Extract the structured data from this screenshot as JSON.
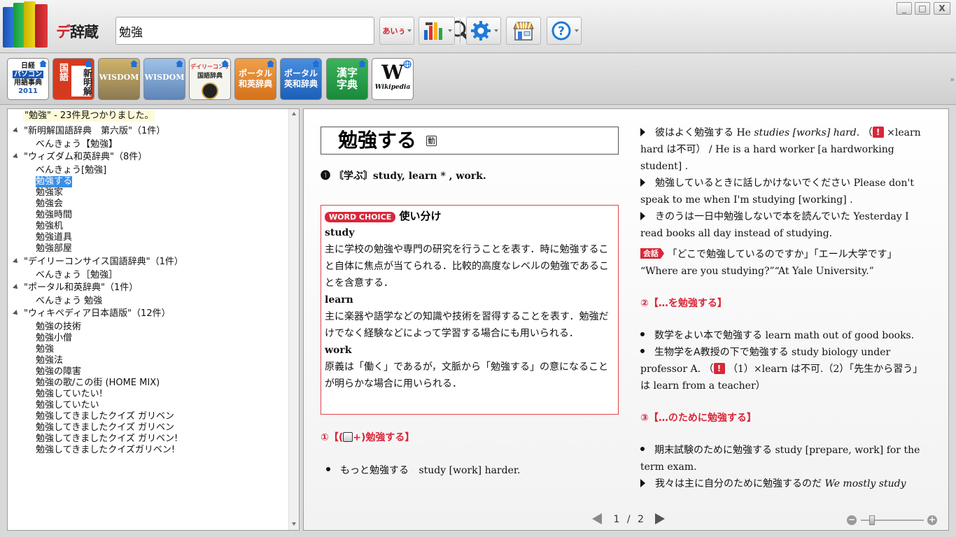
{
  "toolbar": {
    "app_title_prefix": "デ",
    "app_title_rest": "辞蔵",
    "search_value": "勉強",
    "search_placeholder": "",
    "kana_button_label": "あいぅ",
    "icons": [
      "search-icon",
      "histogram-icon",
      "gear-icon",
      "shop-icon",
      "help-icon"
    ]
  },
  "window": {
    "minimize": "_",
    "restore": "□",
    "close": "X"
  },
  "dicts": [
    {
      "label": "日経パソコン用語事典2011",
      "short1": "日経",
      "short2": "パソコン",
      "short3": "用語事典",
      "short4": "2011"
    },
    {
      "label": "新明解国語辞典",
      "short1": "国語",
      "short2": "新明解"
    },
    {
      "label": "ウィズダム英和辞典",
      "short1": "WISDOM"
    },
    {
      "label": "ウィズダム和英辞典",
      "short1": "WISDOM"
    },
    {
      "label": "デイリーコンサイス国語辞典",
      "short1": "デイリーコンサ",
      "short2": "国語辞典"
    },
    {
      "label": "ポータル和英辞典",
      "short1": "ポータル",
      "short2": "和英辞典"
    },
    {
      "label": "ポータル英和辞典",
      "short1": "ポータル",
      "short2": "英和辞典"
    },
    {
      "label": "学研漢字字典",
      "short1": "漢字",
      "short2": "字典"
    },
    {
      "label": "Wikipedia",
      "short1": "W",
      "short2": "Wikipedia"
    }
  ],
  "tree": {
    "summary": "\"勉強\" - 23件見つかりました。",
    "groups": [
      {
        "title": "\"新明解国語辞典　第六版\"（1件）",
        "items": [
          "べんきょう【勉強】"
        ]
      },
      {
        "title": "\"ウィズダム和英辞典\"（8件）",
        "items": [
          "べんきょう[勉強]",
          "勉強する",
          "勉強家",
          "勉強会",
          "勉強時間",
          "勉強机",
          "勉強道具",
          "勉強部屋"
        ]
      },
      {
        "title": "\"デイリーコンサイス国語辞典\"（1件）",
        "items": [
          "べんきょう［勉強］"
        ]
      },
      {
        "title": "\"ポータル和英辞典\"（1件）",
        "items": [
          "べんきょう 勉強"
        ]
      },
      {
        "title": "\"ウィキペディア日本語版\"（12件）",
        "items": [
          "勉強の技術",
          "勉強小僧",
          "勉強",
          "勉強法",
          "勉強の障害",
          "勉強の歌/この街 (HOME MIX)",
          "勉強していたい!",
          "勉強していたい",
          "勉強してきましたクイズ ガリベン",
          "勉強してきましたクイズ ガリベン",
          "勉強してきましたクイズ ガリベン!",
          "勉強してきましたクイズガリベン!"
        ]
      }
    ],
    "selected": "勉強する"
  },
  "entry": {
    "headword": "勉強する",
    "headword_badge": "動",
    "sense1_num": "❶",
    "sense1_text": "〘学ぶ〙study, learn * , work.",
    "wc_badge": "WORD CHOICE",
    "wc_title": "使い分け",
    "wc_study": "study",
    "wc_study_text": "主に学校の勉強や専門の研究を行うことを表す．時に勉強すること自体に焦点が当てられる．比較的高度なレベルの勉強であることを含意する．",
    "wc_learn": "learn",
    "wc_learn_text": "主に楽器や語学などの知識や技術を習得することを表す．勉強だけでなく経験などによって学習する場合にも用いられる．",
    "wc_work": "work",
    "wc_work_text": "原義は「働く」であるが，文脈から「勉強する」の意になることが明らかな場合に用いられる．",
    "sub1": "①【(",
    "sub1b": "+)勉強する】",
    "ex1_ja": "もっと勉強する",
    "ex1_en": "study [work] harder.",
    "r1_ja": "彼はよく勉強する",
    "r1_en_a": "He",
    "r1_en_b": "studies [works] hard.",
    "r1_note_a": "（",
    "r1_note_b": "×learn hard は不可）",
    "r1_en_c": "/ He is a hard worker [a hardworking student] .",
    "r2_ja": "勉強しているときに話しかけないでください",
    "r2_en": "Please don't speak to me when I'm studying [working] .",
    "r3_ja": "きのうは一日中勉強しないで本を読んでいた",
    "r3_en": "Yesterday I read books all day instead of studying.",
    "r4_badge": "会話",
    "r4_ja": "「どこで勉強しているのですか」「エール大学です」",
    "r4_en": "“Where are you studying?”“At Yale University.”",
    "sub2": "②【…を勉強する】",
    "ex2_ja": "数学をよい本で勉強する",
    "ex2_en": "learn math out of good books.",
    "ex3_ja": "生物学をA教授の下で勉強する",
    "ex3_en": "study biology under professor A.",
    "ex3_note_a": "（",
    "ex3_note_b": "（1）×learn は不可.（2）「先生から習う」は learn from a teacher）",
    "sub3": "③【…のために勉強する】",
    "ex4_ja": "期末試験のために勉強する",
    "ex4_en": "study [prepare, work] for the term exam.",
    "ex5_ja": "我々は主に自分のために勉強するのだ",
    "ex5_en": "We mostly study"
  },
  "pager": {
    "current": "1",
    "sep": "/",
    "total": "2"
  },
  "colors": {
    "accent": "#d9273a",
    "selection": "#3a8ee6",
    "gear": "#1e7bd8"
  }
}
